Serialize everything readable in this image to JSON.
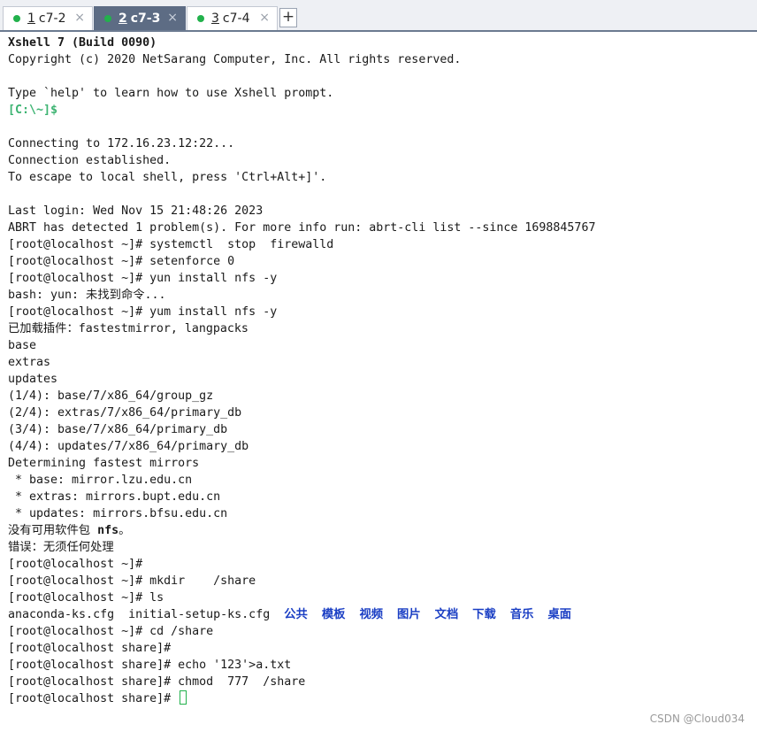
{
  "tabs": [
    {
      "num": "1",
      "label": "c7-2",
      "active": false
    },
    {
      "num": "2",
      "label": "c7-3",
      "active": true
    },
    {
      "num": "3",
      "label": "c7-4",
      "active": false
    }
  ],
  "add_tab_label": "+",
  "close_glyph": "×",
  "terminal": {
    "lines": [
      "Xshell 7 (Build 0090)",
      "Copyright (c) 2020 NetSarang Computer, Inc. All rights reserved.",
      "",
      "Type `help' to learn how to use Xshell prompt.",
      "[C:\\~]$",
      "",
      "Connecting to 172.16.23.12:22...",
      "Connection established.",
      "To escape to local shell, press 'Ctrl+Alt+]'.",
      "",
      "Last login: Wed Nov 15 21:48:26 2023",
      "ABRT has detected 1 problem(s). For more info run: abrt-cli list --since 1698845767",
      "[root@localhost ~]# systemctl  stop  firewalld",
      "[root@localhost ~]# setenforce 0",
      "[root@localhost ~]# yun install nfs -y",
      "bash: yun: 未找到命令...",
      "[root@localhost ~]# yum install nfs -y",
      "已加载插件：fastestmirror, langpacks",
      "base",
      "extras",
      "updates",
      "(1/4): base/7/x86_64/group_gz",
      "(2/4): extras/7/x86_64/primary_db",
      "(3/4): base/7/x86_64/primary_db",
      "(4/4): updates/7/x86_64/primary_db",
      "Determining fastest mirrors",
      " * base: mirror.lzu.edu.cn",
      " * extras: mirrors.bupt.edu.cn",
      " * updates: mirrors.bfsu.edu.cn",
      "没有可用软件包 nfs。",
      "错误：无须任何处理",
      "[root@localhost ~]#",
      "[root@localhost ~]# mkdir    /share",
      "[root@localhost ~]# ls",
      "anaconda-ks.cfg  initial-setup-ks.cfg  ",
      "[root@localhost ~]# cd /share",
      "[root@localhost share]#",
      "[root@localhost share]# echo '123'>a.txt",
      "[root@localhost share]# chmod  777  /share",
      "[root@localhost share]# "
    ],
    "nfs_prefix": "没有可用软件包 ",
    "nfs_bold": "nfs",
    "nfs_suffix": "。",
    "ls_dirs": [
      "公共",
      "模板",
      "视频",
      "图片",
      "文档",
      "下载",
      "音乐",
      "桌面"
    ]
  },
  "colors": {
    "local_prompt": "#3cb371",
    "directory": "#1b3fc4",
    "cursor": "#22b14c",
    "active_tab": "#5d6c84"
  },
  "watermark": "CSDN @Cloud034"
}
